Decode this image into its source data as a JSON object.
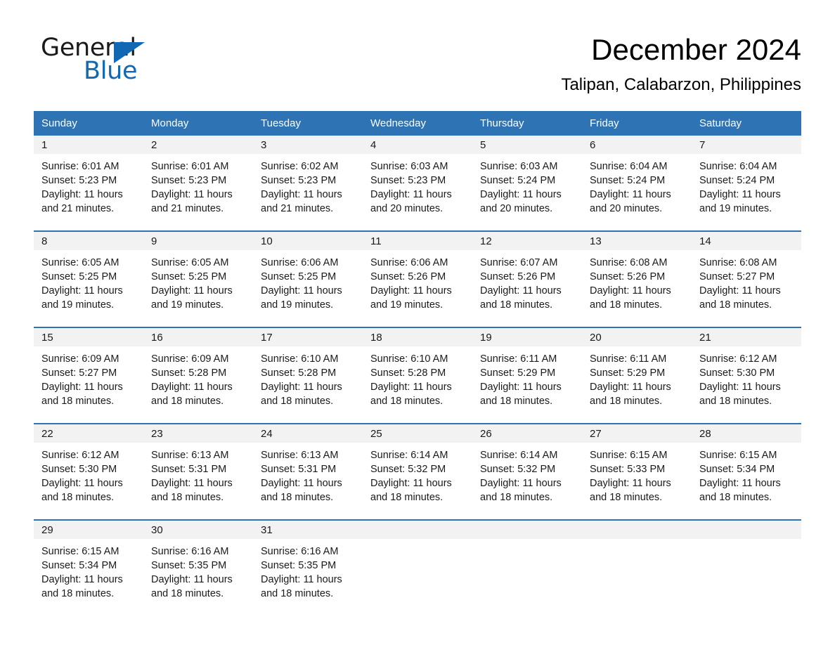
{
  "brand": {
    "word_one": "General",
    "word_two": "Blue",
    "accent_color": "#1268b3",
    "triangle_icon": "triangle-icon"
  },
  "header": {
    "title": "December 2024",
    "subtitle": "Talipan, Calabarzon, Philippines"
  },
  "theme": {
    "header_bg": "#2e74b5",
    "day_band_bg": "#f2f2f2",
    "separator": "#2e74b5"
  },
  "calendar": {
    "weekday_headers": [
      "Sunday",
      "Monday",
      "Tuesday",
      "Wednesday",
      "Thursday",
      "Friday",
      "Saturday"
    ],
    "weeks": [
      [
        {
          "day": "1",
          "sunrise": "Sunrise: 6:01 AM",
          "sunset": "Sunset: 5:23 PM",
          "daylight_line1": "Daylight: 11 hours",
          "daylight_line2": "and 21 minutes."
        },
        {
          "day": "2",
          "sunrise": "Sunrise: 6:01 AM",
          "sunset": "Sunset: 5:23 PM",
          "daylight_line1": "Daylight: 11 hours",
          "daylight_line2": "and 21 minutes."
        },
        {
          "day": "3",
          "sunrise": "Sunrise: 6:02 AM",
          "sunset": "Sunset: 5:23 PM",
          "daylight_line1": "Daylight: 11 hours",
          "daylight_line2": "and 21 minutes."
        },
        {
          "day": "4",
          "sunrise": "Sunrise: 6:03 AM",
          "sunset": "Sunset: 5:23 PM",
          "daylight_line1": "Daylight: 11 hours",
          "daylight_line2": "and 20 minutes."
        },
        {
          "day": "5",
          "sunrise": "Sunrise: 6:03 AM",
          "sunset": "Sunset: 5:24 PM",
          "daylight_line1": "Daylight: 11 hours",
          "daylight_line2": "and 20 minutes."
        },
        {
          "day": "6",
          "sunrise": "Sunrise: 6:04 AM",
          "sunset": "Sunset: 5:24 PM",
          "daylight_line1": "Daylight: 11 hours",
          "daylight_line2": "and 20 minutes."
        },
        {
          "day": "7",
          "sunrise": "Sunrise: 6:04 AM",
          "sunset": "Sunset: 5:24 PM",
          "daylight_line1": "Daylight: 11 hours",
          "daylight_line2": "and 19 minutes."
        }
      ],
      [
        {
          "day": "8",
          "sunrise": "Sunrise: 6:05 AM",
          "sunset": "Sunset: 5:25 PM",
          "daylight_line1": "Daylight: 11 hours",
          "daylight_line2": "and 19 minutes."
        },
        {
          "day": "9",
          "sunrise": "Sunrise: 6:05 AM",
          "sunset": "Sunset: 5:25 PM",
          "daylight_line1": "Daylight: 11 hours",
          "daylight_line2": "and 19 minutes."
        },
        {
          "day": "10",
          "sunrise": "Sunrise: 6:06 AM",
          "sunset": "Sunset: 5:25 PM",
          "daylight_line1": "Daylight: 11 hours",
          "daylight_line2": "and 19 minutes."
        },
        {
          "day": "11",
          "sunrise": "Sunrise: 6:06 AM",
          "sunset": "Sunset: 5:26 PM",
          "daylight_line1": "Daylight: 11 hours",
          "daylight_line2": "and 19 minutes."
        },
        {
          "day": "12",
          "sunrise": "Sunrise: 6:07 AM",
          "sunset": "Sunset: 5:26 PM",
          "daylight_line1": "Daylight: 11 hours",
          "daylight_line2": "and 18 minutes."
        },
        {
          "day": "13",
          "sunrise": "Sunrise: 6:08 AM",
          "sunset": "Sunset: 5:26 PM",
          "daylight_line1": "Daylight: 11 hours",
          "daylight_line2": "and 18 minutes."
        },
        {
          "day": "14",
          "sunrise": "Sunrise: 6:08 AM",
          "sunset": "Sunset: 5:27 PM",
          "daylight_line1": "Daylight: 11 hours",
          "daylight_line2": "and 18 minutes."
        }
      ],
      [
        {
          "day": "15",
          "sunrise": "Sunrise: 6:09 AM",
          "sunset": "Sunset: 5:27 PM",
          "daylight_line1": "Daylight: 11 hours",
          "daylight_line2": "and 18 minutes."
        },
        {
          "day": "16",
          "sunrise": "Sunrise: 6:09 AM",
          "sunset": "Sunset: 5:28 PM",
          "daylight_line1": "Daylight: 11 hours",
          "daylight_line2": "and 18 minutes."
        },
        {
          "day": "17",
          "sunrise": "Sunrise: 6:10 AM",
          "sunset": "Sunset: 5:28 PM",
          "daylight_line1": "Daylight: 11 hours",
          "daylight_line2": "and 18 minutes."
        },
        {
          "day": "18",
          "sunrise": "Sunrise: 6:10 AM",
          "sunset": "Sunset: 5:28 PM",
          "daylight_line1": "Daylight: 11 hours",
          "daylight_line2": "and 18 minutes."
        },
        {
          "day": "19",
          "sunrise": "Sunrise: 6:11 AM",
          "sunset": "Sunset: 5:29 PM",
          "daylight_line1": "Daylight: 11 hours",
          "daylight_line2": "and 18 minutes."
        },
        {
          "day": "20",
          "sunrise": "Sunrise: 6:11 AM",
          "sunset": "Sunset: 5:29 PM",
          "daylight_line1": "Daylight: 11 hours",
          "daylight_line2": "and 18 minutes."
        },
        {
          "day": "21",
          "sunrise": "Sunrise: 6:12 AM",
          "sunset": "Sunset: 5:30 PM",
          "daylight_line1": "Daylight: 11 hours",
          "daylight_line2": "and 18 minutes."
        }
      ],
      [
        {
          "day": "22",
          "sunrise": "Sunrise: 6:12 AM",
          "sunset": "Sunset: 5:30 PM",
          "daylight_line1": "Daylight: 11 hours",
          "daylight_line2": "and 18 minutes."
        },
        {
          "day": "23",
          "sunrise": "Sunrise: 6:13 AM",
          "sunset": "Sunset: 5:31 PM",
          "daylight_line1": "Daylight: 11 hours",
          "daylight_line2": "and 18 minutes."
        },
        {
          "day": "24",
          "sunrise": "Sunrise: 6:13 AM",
          "sunset": "Sunset: 5:31 PM",
          "daylight_line1": "Daylight: 11 hours",
          "daylight_line2": "and 18 minutes."
        },
        {
          "day": "25",
          "sunrise": "Sunrise: 6:14 AM",
          "sunset": "Sunset: 5:32 PM",
          "daylight_line1": "Daylight: 11 hours",
          "daylight_line2": "and 18 minutes."
        },
        {
          "day": "26",
          "sunrise": "Sunrise: 6:14 AM",
          "sunset": "Sunset: 5:32 PM",
          "daylight_line1": "Daylight: 11 hours",
          "daylight_line2": "and 18 minutes."
        },
        {
          "day": "27",
          "sunrise": "Sunrise: 6:15 AM",
          "sunset": "Sunset: 5:33 PM",
          "daylight_line1": "Daylight: 11 hours",
          "daylight_line2": "and 18 minutes."
        },
        {
          "day": "28",
          "sunrise": "Sunrise: 6:15 AM",
          "sunset": "Sunset: 5:34 PM",
          "daylight_line1": "Daylight: 11 hours",
          "daylight_line2": "and 18 minutes."
        }
      ],
      [
        {
          "day": "29",
          "sunrise": "Sunrise: 6:15 AM",
          "sunset": "Sunset: 5:34 PM",
          "daylight_line1": "Daylight: 11 hours",
          "daylight_line2": "and 18 minutes."
        },
        {
          "day": "30",
          "sunrise": "Sunrise: 6:16 AM",
          "sunset": "Sunset: 5:35 PM",
          "daylight_line1": "Daylight: 11 hours",
          "daylight_line2": "and 18 minutes."
        },
        {
          "day": "31",
          "sunrise": "Sunrise: 6:16 AM",
          "sunset": "Sunset: 5:35 PM",
          "daylight_line1": "Daylight: 11 hours",
          "daylight_line2": "and 18 minutes."
        },
        {
          "day": "",
          "sunrise": "",
          "sunset": "",
          "daylight_line1": "",
          "daylight_line2": ""
        },
        {
          "day": "",
          "sunrise": "",
          "sunset": "",
          "daylight_line1": "",
          "daylight_line2": ""
        },
        {
          "day": "",
          "sunrise": "",
          "sunset": "",
          "daylight_line1": "",
          "daylight_line2": ""
        },
        {
          "day": "",
          "sunrise": "",
          "sunset": "",
          "daylight_line1": "",
          "daylight_line2": ""
        }
      ]
    ]
  }
}
